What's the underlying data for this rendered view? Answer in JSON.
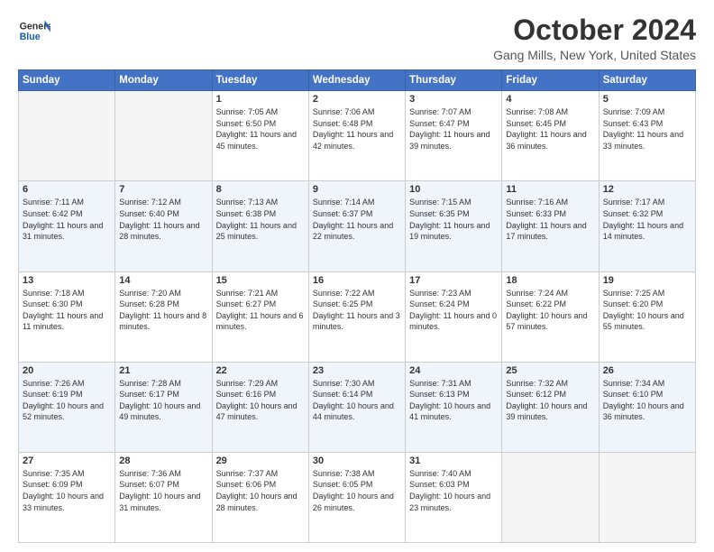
{
  "header": {
    "logo_general": "General",
    "logo_blue": "Blue",
    "month_title": "October 2024",
    "location": "Gang Mills, New York, United States"
  },
  "weekdays": [
    "Sunday",
    "Monday",
    "Tuesday",
    "Wednesday",
    "Thursday",
    "Friday",
    "Saturday"
  ],
  "weeks": [
    [
      {
        "day": "",
        "info": ""
      },
      {
        "day": "",
        "info": ""
      },
      {
        "day": "1",
        "info": "Sunrise: 7:05 AM\nSunset: 6:50 PM\nDaylight: 11 hours and 45 minutes."
      },
      {
        "day": "2",
        "info": "Sunrise: 7:06 AM\nSunset: 6:48 PM\nDaylight: 11 hours and 42 minutes."
      },
      {
        "day": "3",
        "info": "Sunrise: 7:07 AM\nSunset: 6:47 PM\nDaylight: 11 hours and 39 minutes."
      },
      {
        "day": "4",
        "info": "Sunrise: 7:08 AM\nSunset: 6:45 PM\nDaylight: 11 hours and 36 minutes."
      },
      {
        "day": "5",
        "info": "Sunrise: 7:09 AM\nSunset: 6:43 PM\nDaylight: 11 hours and 33 minutes."
      }
    ],
    [
      {
        "day": "6",
        "info": "Sunrise: 7:11 AM\nSunset: 6:42 PM\nDaylight: 11 hours and 31 minutes."
      },
      {
        "day": "7",
        "info": "Sunrise: 7:12 AM\nSunset: 6:40 PM\nDaylight: 11 hours and 28 minutes."
      },
      {
        "day": "8",
        "info": "Sunrise: 7:13 AM\nSunset: 6:38 PM\nDaylight: 11 hours and 25 minutes."
      },
      {
        "day": "9",
        "info": "Sunrise: 7:14 AM\nSunset: 6:37 PM\nDaylight: 11 hours and 22 minutes."
      },
      {
        "day": "10",
        "info": "Sunrise: 7:15 AM\nSunset: 6:35 PM\nDaylight: 11 hours and 19 minutes."
      },
      {
        "day": "11",
        "info": "Sunrise: 7:16 AM\nSunset: 6:33 PM\nDaylight: 11 hours and 17 minutes."
      },
      {
        "day": "12",
        "info": "Sunrise: 7:17 AM\nSunset: 6:32 PM\nDaylight: 11 hours and 14 minutes."
      }
    ],
    [
      {
        "day": "13",
        "info": "Sunrise: 7:18 AM\nSunset: 6:30 PM\nDaylight: 11 hours and 11 minutes."
      },
      {
        "day": "14",
        "info": "Sunrise: 7:20 AM\nSunset: 6:28 PM\nDaylight: 11 hours and 8 minutes."
      },
      {
        "day": "15",
        "info": "Sunrise: 7:21 AM\nSunset: 6:27 PM\nDaylight: 11 hours and 6 minutes."
      },
      {
        "day": "16",
        "info": "Sunrise: 7:22 AM\nSunset: 6:25 PM\nDaylight: 11 hours and 3 minutes."
      },
      {
        "day": "17",
        "info": "Sunrise: 7:23 AM\nSunset: 6:24 PM\nDaylight: 11 hours and 0 minutes."
      },
      {
        "day": "18",
        "info": "Sunrise: 7:24 AM\nSunset: 6:22 PM\nDaylight: 10 hours and 57 minutes."
      },
      {
        "day": "19",
        "info": "Sunrise: 7:25 AM\nSunset: 6:20 PM\nDaylight: 10 hours and 55 minutes."
      }
    ],
    [
      {
        "day": "20",
        "info": "Sunrise: 7:26 AM\nSunset: 6:19 PM\nDaylight: 10 hours and 52 minutes."
      },
      {
        "day": "21",
        "info": "Sunrise: 7:28 AM\nSunset: 6:17 PM\nDaylight: 10 hours and 49 minutes."
      },
      {
        "day": "22",
        "info": "Sunrise: 7:29 AM\nSunset: 6:16 PM\nDaylight: 10 hours and 47 minutes."
      },
      {
        "day": "23",
        "info": "Sunrise: 7:30 AM\nSunset: 6:14 PM\nDaylight: 10 hours and 44 minutes."
      },
      {
        "day": "24",
        "info": "Sunrise: 7:31 AM\nSunset: 6:13 PM\nDaylight: 10 hours and 41 minutes."
      },
      {
        "day": "25",
        "info": "Sunrise: 7:32 AM\nSunset: 6:12 PM\nDaylight: 10 hours and 39 minutes."
      },
      {
        "day": "26",
        "info": "Sunrise: 7:34 AM\nSunset: 6:10 PM\nDaylight: 10 hours and 36 minutes."
      }
    ],
    [
      {
        "day": "27",
        "info": "Sunrise: 7:35 AM\nSunset: 6:09 PM\nDaylight: 10 hours and 33 minutes."
      },
      {
        "day": "28",
        "info": "Sunrise: 7:36 AM\nSunset: 6:07 PM\nDaylight: 10 hours and 31 minutes."
      },
      {
        "day": "29",
        "info": "Sunrise: 7:37 AM\nSunset: 6:06 PM\nDaylight: 10 hours and 28 minutes."
      },
      {
        "day": "30",
        "info": "Sunrise: 7:38 AM\nSunset: 6:05 PM\nDaylight: 10 hours and 26 minutes."
      },
      {
        "day": "31",
        "info": "Sunrise: 7:40 AM\nSunset: 6:03 PM\nDaylight: 10 hours and 23 minutes."
      },
      {
        "day": "",
        "info": ""
      },
      {
        "day": "",
        "info": ""
      }
    ]
  ]
}
